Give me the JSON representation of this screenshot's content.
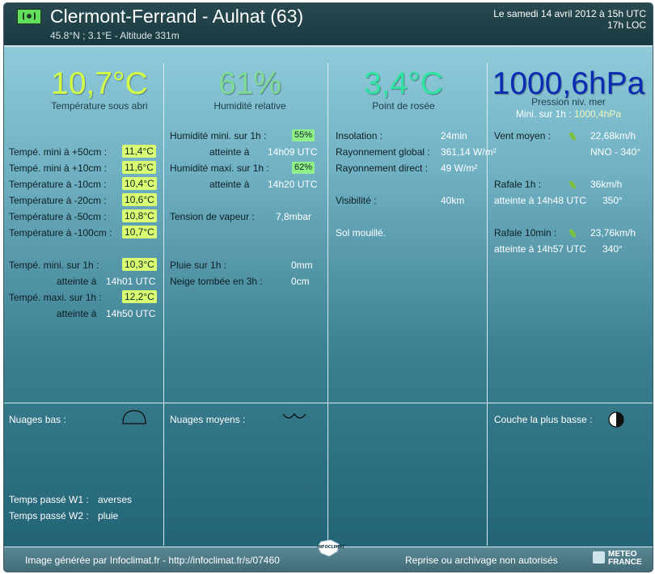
{
  "header": {
    "station": "Clermont-Ferrand - Aulnat (63)",
    "subtitle": "45.8°N ; 3.1°E - Altitude 331m",
    "date": "Le samedi 14 avril 2012 à 15h UTC",
    "local_time": "17h LOC"
  },
  "top": {
    "temp": {
      "value": "10,7°C",
      "label": "Température sous abri",
      "color": "#d4ff47"
    },
    "humidity": {
      "value": "61%",
      "label": "Humidité relative",
      "color": "#7edb96"
    },
    "dew": {
      "value": "3,4°C",
      "label": "Point de rosée",
      "color": "#31e3a2"
    },
    "pressure": {
      "value": "1000,6hPa",
      "label": "Pression niv. mer",
      "min_label": "Mini. sur 1h :",
      "min_value": "1000,4hPa",
      "color": "#0b2bb5"
    }
  },
  "col1": {
    "rows": [
      {
        "label": "Tempé. mini à +50cm :",
        "value": "11,4°C"
      },
      {
        "label": "Tempé. mini à +10cm :",
        "value": "11,6°C"
      },
      {
        "label": "Température à -10cm :",
        "value": "10,4°C"
      },
      {
        "label": "Température à -20cm :",
        "value": "10,6°C"
      },
      {
        "label": "Température à -50cm :",
        "value": "10,8°C"
      },
      {
        "label": "Température à -100cm :",
        "value": "10,7°C"
      }
    ],
    "tmin_label": "Tempé. mini. sur 1h :",
    "tmin_value": "10,3°C",
    "tmin_at_label": "atteinte à",
    "tmin_at": "14h01 UTC",
    "tmax_label": "Tempé. maxi. sur 1h :",
    "tmax_value": "12,2°C",
    "tmax_at_label": "atteinte à",
    "tmax_at": "14h50 UTC"
  },
  "col2": {
    "hmin_label": "Humidité mini. sur 1h :",
    "hmin_value": "55%",
    "hmin_at_label": "atteinte à",
    "hmin_at": "14h09 UTC",
    "hmax_label": "Humidité maxi. sur 1h :",
    "hmax_value": "62%",
    "hmax_at_label": "atteinte à",
    "hmax_at": "14h20 UTC",
    "vapor_label": "Tension de vapeur :",
    "vapor_value": "7,8mbar",
    "rain_label": "Pluie sur 1h :",
    "rain_value": "0mm",
    "snow_label": "Neige tombée en 3h :",
    "snow_value": "0cm"
  },
  "col3": {
    "insol_label": "Insolation :",
    "insol_value": "24min",
    "global_label": "Rayonnement global :",
    "global_value": "361,14 W/m²",
    "direct_label": "Rayonnement direct :",
    "direct_value": "49 W/m²",
    "vis_label": "Visibilité :",
    "vis_value": "40km",
    "soil": "Sol mouillé."
  },
  "col4": {
    "wind_label": "Vent moyen :",
    "wind_value": "22,68km/h",
    "wind_dir": "NNO - 340°",
    "gust1_label": "Rafale 1h :",
    "gust1_value": "36km/h",
    "gust1_at": "atteinte à 14h48 UTC",
    "gust1_dir": "350°",
    "gust10_label": "Rafale 10min :",
    "gust10_value": "23,76km/h",
    "gust10_at": "atteinte à 14h57 UTC",
    "gust10_dir": "340°"
  },
  "bottom": {
    "low_label": "Nuages bas :",
    "mid_label": "Nuages moyens :",
    "lowest_label": "Couche la plus basse :",
    "w1_label": "Temps passé W1 :",
    "w1_value": "averses",
    "w2_label": "Temps passé W2 :",
    "w2_value": "pluie"
  },
  "footer": {
    "left": "Image générée par Infoclimat.fr - http://infoclimat.fr/s/07460",
    "right": "Reprise ou archivage non autorisés",
    "logo_text": "METEO FRANCE",
    "mini_logo_text": "INFOCLIMAT"
  }
}
